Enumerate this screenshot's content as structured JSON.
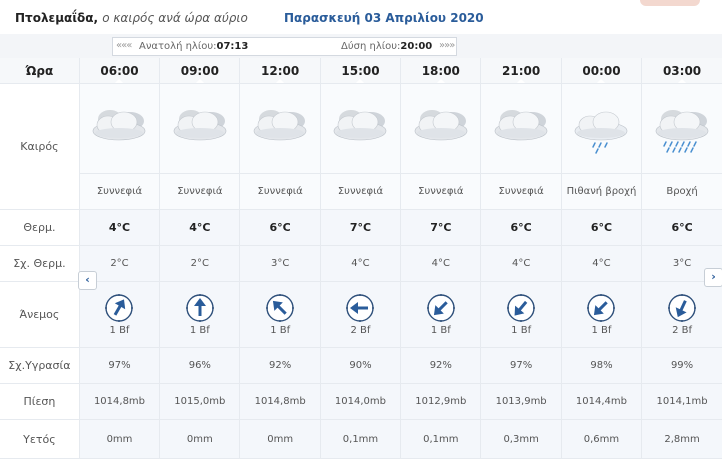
{
  "header": {
    "city": "Πτολεμαΐδα,",
    "subtitle": "ο καιρός ανά ώρα αύριο",
    "date": "Παρασκευή 03 Απριλίου 2020"
  },
  "sun": {
    "sunrise_label": "Ανατολή ηλίου:",
    "sunrise_time": "07:13",
    "sunset_label": "Δύση ηλίου:",
    "sunset_time": "20:00",
    "prev_glyph": "«««",
    "next_glyph": "»»»"
  },
  "labels": {
    "hour": "Ώρα",
    "weather": "Καιρός",
    "temp": "Θερμ.",
    "feels": "Σχ. Θερμ.",
    "wind": "Άνεμος",
    "humidity": "Σχ.Υγρασία",
    "pressure": "Πίεση",
    "rain": "Υετός"
  },
  "nav": {
    "left": "‹",
    "right": "›"
  },
  "columns": [
    {
      "hour": "06:00",
      "icon": "cloudy-icon",
      "desc": "Συννεφιά",
      "temp": "4°C",
      "feels": "2°C",
      "wind_deg": 30,
      "wind": "1 Bf",
      "humidity": "97%",
      "pressure": "1014,8mb",
      "rain": "0mm"
    },
    {
      "hour": "09:00",
      "icon": "cloudy-icon",
      "desc": "Συννεφιά",
      "temp": "4°C",
      "feels": "2°C",
      "wind_deg": 0,
      "wind": "1 Bf",
      "humidity": "96%",
      "pressure": "1015,0mb",
      "rain": "0mm"
    },
    {
      "hour": "12:00",
      "icon": "cloudy-icon",
      "desc": "Συννεφιά",
      "temp": "6°C",
      "feels": "3°C",
      "wind_deg": -45,
      "wind": "1 Bf",
      "humidity": "92%",
      "pressure": "1014,8mb",
      "rain": "0mm"
    },
    {
      "hour": "15:00",
      "icon": "cloudy-icon",
      "desc": "Συννεφιά",
      "temp": "7°C",
      "feels": "4°C",
      "wind_deg": -90,
      "wind": "2 Bf",
      "humidity": "90%",
      "pressure": "1014,0mb",
      "rain": "0,1mm"
    },
    {
      "hour": "18:00",
      "icon": "cloudy-icon",
      "desc": "Συννεφιά",
      "temp": "7°C",
      "feels": "4°C",
      "wind_deg": -135,
      "wind": "1 Bf",
      "humidity": "92%",
      "pressure": "1012,9mb",
      "rain": "0,1mm"
    },
    {
      "hour": "21:00",
      "icon": "cloudy-icon",
      "desc": "Συννεφιά",
      "temp": "6°C",
      "feels": "4°C",
      "wind_deg": -140,
      "wind": "1 Bf",
      "humidity": "97%",
      "pressure": "1013,9mb",
      "rain": "0,3mm"
    },
    {
      "hour": "00:00",
      "icon": "light-rain-icon",
      "desc": "Πιθανή βροχή",
      "temp": "6°C",
      "feels": "4°C",
      "wind_deg": -135,
      "wind": "1 Bf",
      "humidity": "98%",
      "pressure": "1014,4mb",
      "rain": "0,6mm"
    },
    {
      "hour": "03:00",
      "icon": "rain-icon",
      "desc": "Βροχή",
      "temp": "6°C",
      "feels": "3°C",
      "wind_deg": -155,
      "wind": "2 Bf",
      "humidity": "99%",
      "pressure": "1014,1mb",
      "rain": "2,8mm"
    }
  ],
  "colors": {
    "accent": "#2a5c9a",
    "cell_bg": "#f4f7fb",
    "header_bg": "#f6f8fa"
  }
}
